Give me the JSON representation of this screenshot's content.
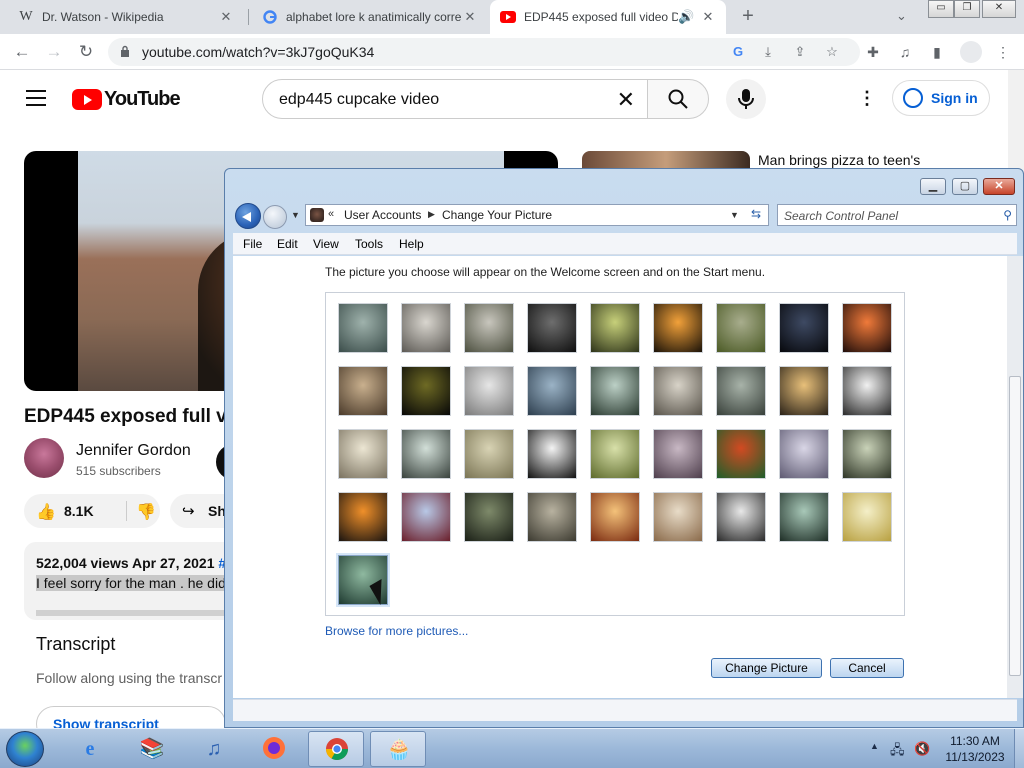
{
  "browser": {
    "tabs": [
      {
        "title": "Dr. Watson - Wikipedia",
        "icon": "wikipedia-w",
        "active": false
      },
      {
        "title": "alphabet lore k anatimically corre",
        "icon": "google-g",
        "active": false
      },
      {
        "title": "EDP445 exposed full video D",
        "icon": "youtube-play",
        "active": true
      }
    ],
    "url": "youtube.com/watch?v=3kJ7goQuK34"
  },
  "youtube": {
    "logo_text": "YouTube",
    "search_query": "edp445 cupcake video",
    "signin_label": "Sign in",
    "video_title": "EDP445 exposed full v",
    "channel_name": "Jennifer Gordon",
    "subscribers": "515 subscribers",
    "likes": "8.1K",
    "share_label": "Sh",
    "views_date": "522,004 views  Apr 27, 2021",
    "hashtag_fragment": "#",
    "desc_selected": "I feel sorry for the man . he did",
    "transcript_heading": "Transcript",
    "transcript_sub": "Follow along using the transcr",
    "transcript_button": "Show transcript",
    "side_title": "Man brings pizza to teen's"
  },
  "dialog": {
    "breadcrumb": [
      "User Accounts",
      "Change Your Picture"
    ],
    "search_placeholder": "Search Control Panel",
    "menu": [
      "File",
      "Edit",
      "View",
      "Tools",
      "Help"
    ],
    "hint": "The picture you choose will appear on the Welcome screen and on the Start menu.",
    "browse_link": "Browse for more pictures...",
    "buttons": {
      "change": "Change Picture",
      "cancel": "Cancel"
    },
    "pictures": [
      {
        "name": "forest-path",
        "c1": "#9fb2ac",
        "c2": "#3b4d4a"
      },
      {
        "name": "gramophone",
        "c1": "#d9d6cf",
        "c2": "#5c5954"
      },
      {
        "name": "stormy-hills",
        "c1": "#c8c6bd",
        "c2": "#4d5040"
      },
      {
        "name": "skeleton-creature",
        "c1": "#6e6e6e",
        "c2": "#0e0e0e"
      },
      {
        "name": "haunted-tree-house",
        "c1": "#c7d07a",
        "c2": "#2d3319"
      },
      {
        "name": "orange-night-castle",
        "c1": "#f2a13a",
        "c2": "#1a1208"
      },
      {
        "name": "green-field-figure",
        "c1": "#a8ad8d",
        "c2": "#4b5a25"
      },
      {
        "name": "dark-stage",
        "c1": "#3e4a63",
        "c2": "#07080c"
      },
      {
        "name": "fire-road",
        "c1": "#f07a3a",
        "c2": "#1f0d0a"
      },
      {
        "name": "rusted-box",
        "c1": "#c9b08e",
        "c2": "#4a3a2a"
      },
      {
        "name": "cat-eye",
        "c1": "#6e6a24",
        "c2": "#070707"
      },
      {
        "name": "lighthouse-clouds",
        "c1": "#e6e6e6",
        "c2": "#7a7a7a"
      },
      {
        "name": "blue-tower",
        "c1": "#9bb3c6",
        "c2": "#2d3e4e"
      },
      {
        "name": "winged-creature",
        "c1": "#bcd0c6",
        "c2": "#2a3a30"
      },
      {
        "name": "sphere-ruins",
        "c1": "#d8d3c8",
        "c2": "#58534a"
      },
      {
        "name": "misty-fog",
        "c1": "#a8b3a9",
        "c2": "#38403a"
      },
      {
        "name": "melting-clock",
        "c1": "#e8c07a",
        "c2": "#2a2218"
      },
      {
        "name": "eyeball-bird",
        "c1": "#f1f1f1",
        "c2": "#2a2a2a"
      },
      {
        "name": "birdcage",
        "c1": "#ece6d3",
        "c2": "#7a7260"
      },
      {
        "name": "tree-box",
        "c1": "#d2dfd8",
        "c2": "#39423d"
      },
      {
        "name": "pyramid",
        "c1": "#d8d3b4",
        "c2": "#7a7454"
      },
      {
        "name": "ink-splat",
        "c1": "#f4f4f4",
        "c2": "#111111"
      },
      {
        "name": "green-sheep",
        "c1": "#d8e0a9",
        "c2": "#5d6a2c"
      },
      {
        "name": "rail-tracks",
        "c1": "#c8b8c4",
        "c2": "#4e3e4c"
      },
      {
        "name": "red-green-orb",
        "c1": "#d24a22",
        "c2": "#1e5e2a"
      },
      {
        "name": "creature-eye",
        "c1": "#d9d6e6",
        "c2": "#5e5a72"
      },
      {
        "name": "green-castle",
        "c1": "#c9d2b8",
        "c2": "#2e3526"
      },
      {
        "name": "flame-dragon",
        "c1": "#f0902a",
        "c2": "#1a1410"
      },
      {
        "name": "fairy-red",
        "c1": "#b8c8e6",
        "c2": "#6a1e2a"
      },
      {
        "name": "dark-forest",
        "c1": "#7e8a6a",
        "c2": "#1a1f16"
      },
      {
        "name": "ruined-bridge",
        "c1": "#b8b2a0",
        "c2": "#3c3a30"
      },
      {
        "name": "fire-dancer",
        "c1": "#f4c27a",
        "c2": "#7a2a10"
      },
      {
        "name": "eiffel-clouds",
        "c1": "#e8dcc8",
        "c2": "#8a6a4a"
      },
      {
        "name": "empty-chair",
        "c1": "#e8e8e8",
        "c2": "#2a2a2a"
      },
      {
        "name": "rider-lizard",
        "c1": "#a8c8b8",
        "c2": "#1e2e26"
      },
      {
        "name": "yellow-plane",
        "c1": "#f4efc8",
        "c2": "#b8a040"
      },
      {
        "name": "green-cube",
        "c1": "#8fb9a0",
        "c2": "#1e3a30"
      }
    ]
  },
  "taskbar": {
    "apps": [
      "internet-explorer",
      "winrar",
      "itunes",
      "firefox",
      "chrome",
      "cupcake-picture"
    ],
    "time": "11:30 AM",
    "date": "11/13/2023"
  }
}
